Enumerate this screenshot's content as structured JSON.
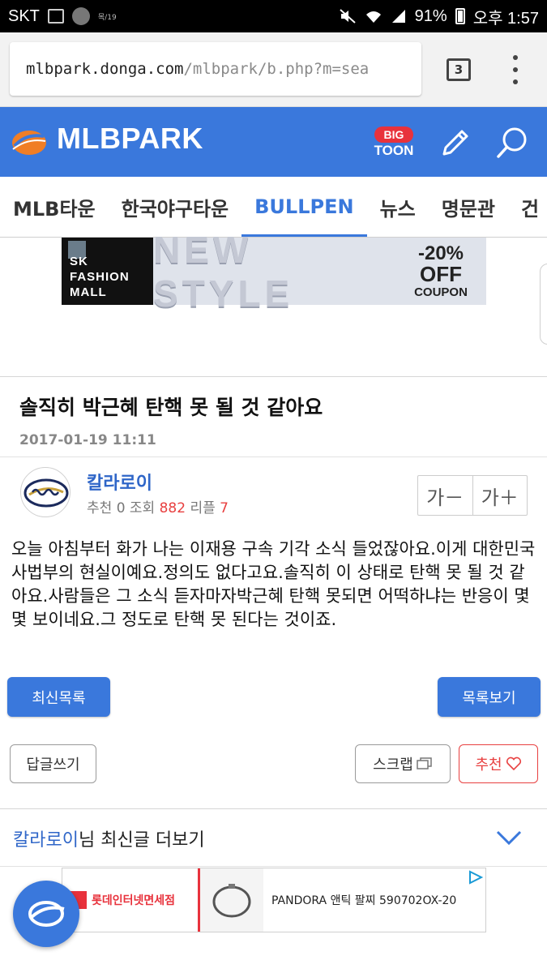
{
  "status_bar": {
    "carrier": "SKT",
    "notification_label": "목/19",
    "battery": "91%",
    "time": "오후 1:57"
  },
  "browser": {
    "url_host": "mlbpark.donga.com",
    "url_path": "/mlbpark/b.php?m=sea",
    "tab_count": "3"
  },
  "header": {
    "logo_text": "MLBPARK",
    "bigtoon_top": "BIG",
    "bigtoon_bottom": "TOON"
  },
  "nav": {
    "tabs": [
      {
        "label": "MLB타운",
        "active": false
      },
      {
        "label": "한국야구타운",
        "active": false
      },
      {
        "label": "BULLPEN",
        "active": true
      },
      {
        "label": "뉴스",
        "active": false
      },
      {
        "label": "명문관",
        "active": false
      },
      {
        "label": "건",
        "active": false
      }
    ]
  },
  "ad_banner": {
    "brand_line1": "SK",
    "brand_line2": "FASHION",
    "brand_line3": "MALL",
    "headline": "NEW STYLE",
    "discount": "-20%",
    "off": "OFF",
    "coupon": "COUPON"
  },
  "post": {
    "title": "솔직히 박근혜 탄핵 못 될 것 같아요",
    "date": "2017-01-19 11:11",
    "author": "칼라로이",
    "stats_reco_label": "추천",
    "stats_reco": "0",
    "stats_views_label": "조회",
    "stats_views": "882",
    "stats_replies_label": "리플",
    "stats_replies": "7",
    "font_smaller": "가－",
    "font_larger": "가＋",
    "body": "오늘 아침부터 화가 나는 이재용 구속 기각 소식 들었잖아요.이게 대한민국 사법부의 현실이예요.정의도 없다고요.솔직히 이 상태로 탄핵 못 될 것 같아요.사람들은 그 소식 듣자마자박근혜 탄핵 못되면 어떡하냐는 반응이 몇몇 보이네요.그 정도로 탄핵 못 된다는 것이죠."
  },
  "actions": {
    "latest_list": "최신목록",
    "view_list": "목록보기",
    "reply": "답글쓰기",
    "scrap": "스크랩",
    "recommend": "추천"
  },
  "more": {
    "author": "칼라로이",
    "suffix": "님 최신글 더보기"
  },
  "bottom_ad": {
    "store": "롯데인터넷면세점",
    "product": "PANDORA 앤틱 팔찌 590702OX-20"
  },
  "colors": {
    "brand_blue": "#3a78dc",
    "accent_red": "#e84040"
  }
}
